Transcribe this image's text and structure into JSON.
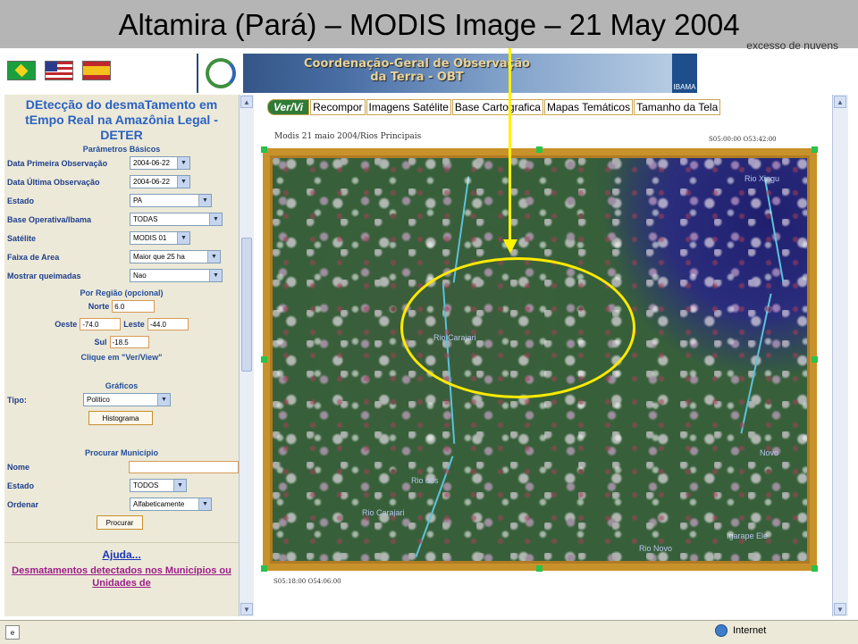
{
  "slide": {
    "title": "Altamira (Pará) – MODIS Image – 21 May 2004",
    "cloud_note": "excesso de nuvens"
  },
  "banner": {
    "line1": "Coordenação-Geral de Observação",
    "line2": "da Terra - OBT",
    "ibama": "IBAMA"
  },
  "flags": [
    "brazil-flag",
    "usa-flag",
    "spain-flag"
  ],
  "sidebar": {
    "title": "DEtecção do desmaTamento em tEmpo Real na Amazônia Legal - DETER",
    "params_header": "Parâmetros Básicos",
    "fields": [
      {
        "label": "Data Primeira Observação",
        "value": "2004-06-22"
      },
      {
        "label": "Data Última Observação",
        "value": "2004-06-22"
      },
      {
        "label": "Estado",
        "value": "PA"
      },
      {
        "label": "Base Operativa/Ibama",
        "value": "TODAS"
      },
      {
        "label": "Satélite",
        "value": "MODIS 01"
      },
      {
        "label": "Faixa de Area",
        "value": "Maior que 25 ha"
      },
      {
        "label": "Mostrar queimadas",
        "value": "Nao"
      }
    ],
    "region_header": "Por Região (opcional)",
    "norte_label": "Norte",
    "norte_value": "6.0",
    "oeste_label": "Oeste",
    "oeste_value": "-74.0",
    "leste_label": "Leste",
    "leste_value": "-44.0",
    "sul_label": "Sul",
    "sul_value": "-18.5",
    "click_hint": "Clique em \"Ver/View\"",
    "graficos_header": "Gráficos",
    "tipo_label": "Tipo:",
    "tipo_value": "Politico",
    "histograma_button": "Histograma",
    "municipio_header": "Procurar Município",
    "nome_label": "Nome",
    "estado_label": "Estado",
    "estado_value": "TODOS",
    "ordenar_label": "Ordenar",
    "ordenar_value": "Alfabeticamente",
    "procurar_button": "Procurar",
    "help_link": "Ajuda...",
    "desm_link": "Desmatamentos detectados nos Municípios ou Unidades de"
  },
  "tabs": [
    "Ver/Vi",
    "Recompor",
    "Imagens Satélite",
    "Base Cartografica",
    "Mapas Temáticos",
    "Tamanho da Tela"
  ],
  "map": {
    "caption": "Modis 21 maio 2004/Rios Principais",
    "coord_top_right": "S05:00:00 O53:42:00",
    "coord_bottom_left": "S05:18:00 O54:06:00",
    "labels": {
      "rio_xingu": "Rio Xingu",
      "rio_carajari": "Rio Carajari",
      "novo": "Novo",
      "rio_dos": "Rio dos",
      "rio_carajari2": "Rio Carajari",
      "rio_novo": "Rio Novo",
      "igarape": "Igarape Ele"
    }
  },
  "status": {
    "zone": "Internet"
  },
  "colors": {
    "annotation": "#fff200",
    "frame": "#c8922a",
    "tab_active": "#2f7a37"
  }
}
